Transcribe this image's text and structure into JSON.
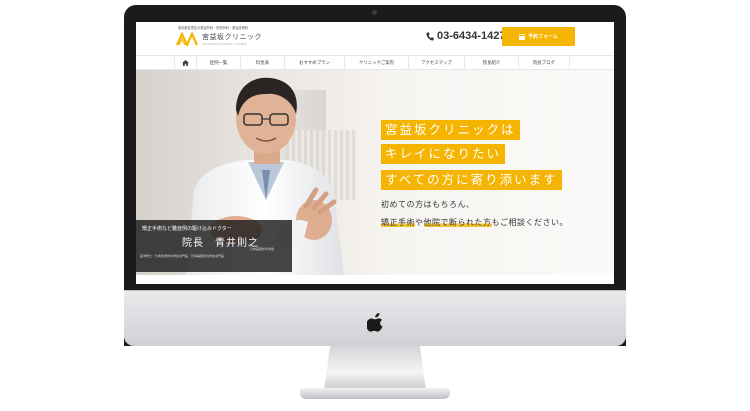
{
  "header": {
    "tagline": "東京都目黒区の美容外科・形成外科・美容皮膚科",
    "logo_name": "宮益坂クリニック",
    "logo_en": "MIYAMASUZAKA CLINIC",
    "phone": "03-6434-1427",
    "reserve_label": "予約フォーム"
  },
  "nav": {
    "items": [
      {
        "label": "症例一覧"
      },
      {
        "label": "料金表"
      },
      {
        "label": "おすすめプラン"
      },
      {
        "label": "クリニックご案内"
      },
      {
        "label": "アクセスマップ"
      },
      {
        "label": "院長紹介"
      },
      {
        "label": "院長ブログ"
      }
    ]
  },
  "hero": {
    "headline": [
      "宮益坂クリニックは",
      "キレイになりたい",
      "すべての方に寄り添います"
    ],
    "sub_line1": "初めての方はもちろん、",
    "sub_line2_a": "矯正手術",
    "sub_line2_b": "や",
    "sub_line2_c": "他院で断られた方",
    "sub_line2_d": "もご相談ください。",
    "caption": {
      "subtitle": "矯正手術など難症例の駆け込みドクター",
      "name": "院長　青井則之",
      "association": "日本美容外科学会",
      "certifications": "医学博士／日本形成外科学会専門医／日本美容外科学会専門医"
    }
  },
  "colors": {
    "accent": "#f4b400",
    "bezel": "#1b1b1d",
    "caption_bg": "#1c1c1c"
  }
}
